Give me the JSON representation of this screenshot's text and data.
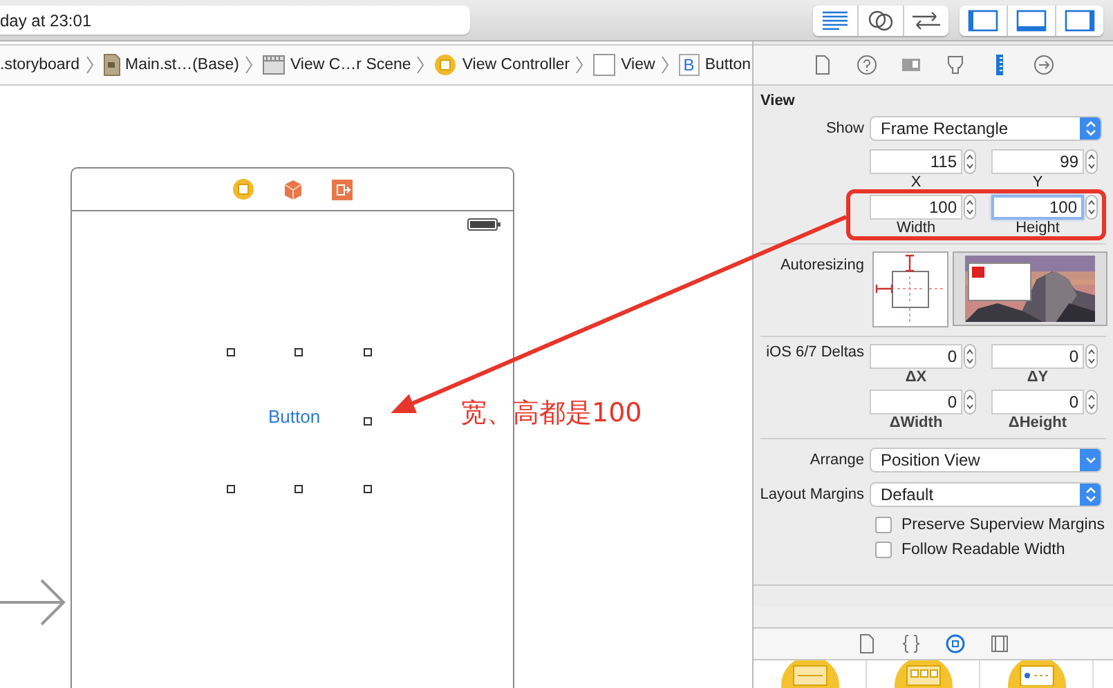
{
  "toolbar": {
    "status_text": "day at 23:01",
    "editor_modes": [
      {
        "selected": true
      },
      {
        "selected": false
      },
      {
        "selected": false
      }
    ],
    "panels": [
      {
        "on": true
      },
      {
        "on": true
      },
      {
        "on": true
      }
    ]
  },
  "breadcrumb": [
    {
      "label": ".storyboard",
      "kind": "none"
    },
    {
      "label": "Main.st…(Base)",
      "kind": "storyboard"
    },
    {
      "label": "View C…r Scene",
      "kind": "scene"
    },
    {
      "label": "View Controller",
      "kind": "controller"
    },
    {
      "label": "View",
      "kind": "view"
    },
    {
      "label": "Button",
      "kind": "button",
      "glyph": "B"
    }
  ],
  "scene": {
    "button_label": "Button"
  },
  "annotation": {
    "text": "宽、高都是100"
  },
  "inspector": {
    "tabs": [
      {
        "selected": false
      },
      {
        "selected": false
      },
      {
        "selected": false
      },
      {
        "selected": false
      },
      {
        "selected": true
      },
      {
        "selected": false
      }
    ],
    "section_title": "View",
    "show": {
      "label": "Show",
      "value": "Frame Rectangle",
      "kind": "popup"
    },
    "frame": [
      {
        "value": "115",
        "caption": "X",
        "focused": false
      },
      {
        "value": "99",
        "caption": "Y",
        "focused": false
      },
      {
        "value": "100",
        "caption": "Width",
        "focused": false
      },
      {
        "value": "100",
        "caption": "Height",
        "focused": true
      }
    ],
    "autoresizing_label": "Autoresizing",
    "deltas_label": "iOS 6/7 Deltas",
    "deltas": [
      {
        "value": "0",
        "caption": "ΔX"
      },
      {
        "value": "0",
        "caption": "ΔY"
      },
      {
        "value": "0",
        "caption": "ΔWidth"
      },
      {
        "value": "0",
        "caption": "ΔHeight"
      }
    ],
    "arrange": {
      "label": "Arrange",
      "value": "Position View",
      "kind": "pulldown"
    },
    "margins": {
      "label": "Layout Margins",
      "value": "Default",
      "kind": "popup"
    },
    "checkboxes": [
      {
        "label": "Preserve Superview Margins",
        "checked": false
      },
      {
        "label": "Follow Readable Width",
        "checked": false
      }
    ]
  },
  "library_tabs": [
    {
      "selected": false
    },
    {
      "selected": false
    },
    {
      "selected": true
    },
    {
      "selected": false
    }
  ]
}
